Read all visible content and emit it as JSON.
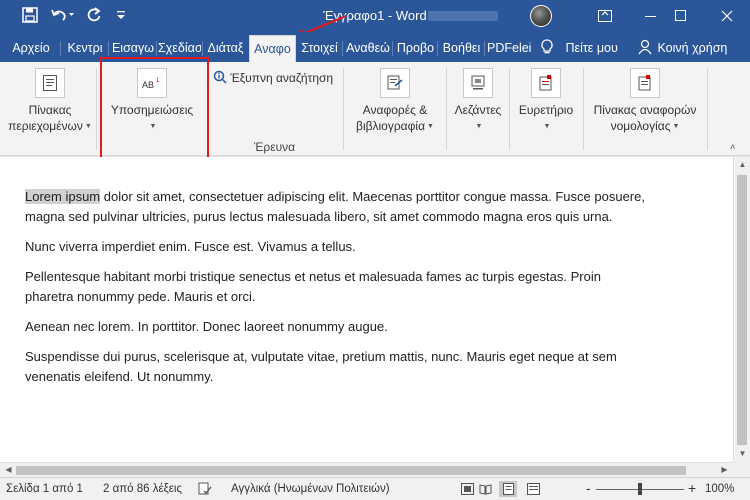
{
  "window": {
    "title": "Έγγραφο1 - Word",
    "controls": [
      "ribbon-display-options",
      "minimize",
      "maximize",
      "close"
    ]
  },
  "quick_access": [
    "save-icon",
    "undo-icon",
    "redo-icon"
  ],
  "tabs": [
    {
      "label": "Αρχείο"
    },
    {
      "label": "Κεντρι"
    },
    {
      "label": "Εισαγω"
    },
    {
      "label": "Σχεδίασ"
    },
    {
      "label": "Διάταξ"
    },
    {
      "label": "Αναφο",
      "active": true
    },
    {
      "label": "Στοιχεί"
    },
    {
      "label": "Αναθεώ"
    },
    {
      "label": "Προβο"
    },
    {
      "label": "Βοήθει"
    },
    {
      "label": "PDFelei"
    }
  ],
  "tell_me": "Πείτε μου",
  "share": "Κοινή χρήση",
  "ribbon": {
    "toc_line1": "Πίνακας",
    "toc_line2": "περιεχομένων",
    "footnotes": "Υποσημειώσεις",
    "smart_lookup": "Έξυπνη αναζήτηση",
    "research_group": "Έρευνα",
    "citations_line1": "Αναφορές &",
    "citations_line2": "βιβλιογραφία",
    "captions": "Λεζάντες",
    "index": "Ευρετήριο",
    "toa_line1": "Πίνακας αναφορών",
    "toa_line2": "νομολογίας"
  },
  "document": {
    "paragraphs": [
      {
        "highlight": "Lorem ipsum",
        "text": " dolor sit amet, consectetuer adipiscing elit. Maecenas porttitor congue massa. Fusce posuere, magna sed pulvinar ultricies, purus lectus malesuada libero, sit amet commodo magna eros quis urna."
      },
      {
        "text": "Nunc viverra imperdiet enim. Fusce est. Vivamus a tellus."
      },
      {
        "text": "Pellentesque habitant morbi tristique senectus et netus et malesuada fames ac turpis egestas. Proin pharetra nonummy pede. Mauris et orci."
      },
      {
        "text": "Aenean nec lorem. In porttitor. Donec laoreet nonummy augue."
      },
      {
        "text": "Suspendisse dui purus, scelerisque at, vulputate vitae, pretium mattis, nunc. Mauris eget neque at sem venenatis eleifend. Ut nonummy."
      }
    ]
  },
  "status": {
    "page": "Σελίδα 1 από 1",
    "words": "2 από 86 λέξεις",
    "language": "Αγγλικά (Ηνωμένων Πολιτειών)",
    "zoom": "100%",
    "zoom_minus": "-",
    "zoom_plus": "+"
  },
  "colors": {
    "accent": "#2b579a",
    "annotation_box": "#e21b1b"
  }
}
